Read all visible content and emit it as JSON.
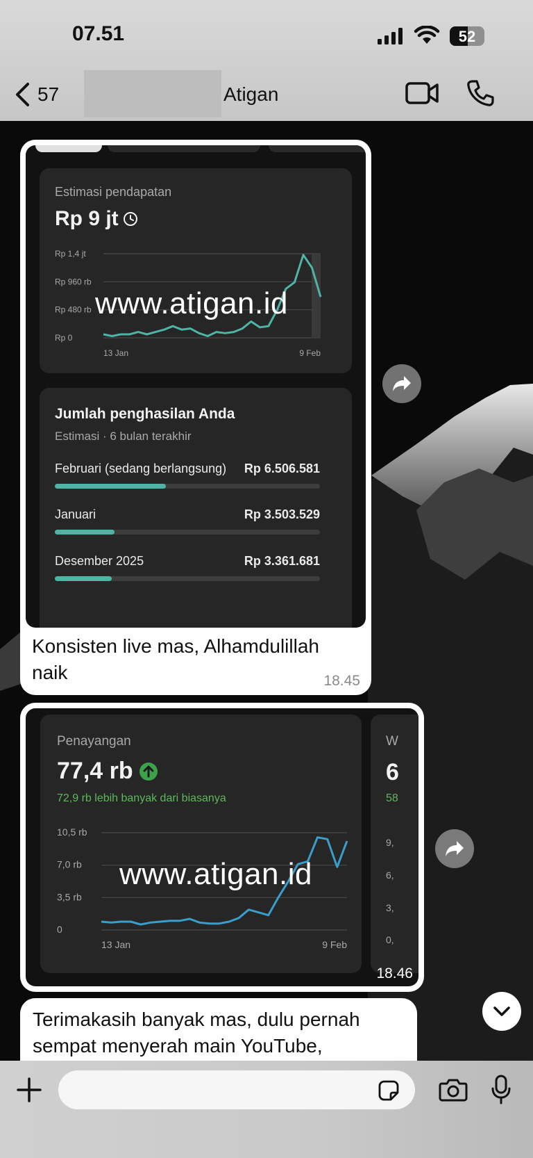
{
  "status": {
    "time": "07.51",
    "battery": "52",
    "battery_level": 0.52
  },
  "header": {
    "back_count": "57",
    "contact_name": "Atigan"
  },
  "message1": {
    "card_earnings": {
      "title": "Estimasi pendapatan",
      "value": "Rp 9 jt",
      "y_ticks": [
        "Rp 1,4 jt",
        "Rp 960 rb",
        "Rp 480 rb",
        "Rp 0"
      ],
      "x_start": "13 Jan",
      "x_end": "9 Feb"
    },
    "card_income": {
      "title": "Jumlah penghasilan Anda",
      "subtitle": "Estimasi · 6 bulan terakhir",
      "rows": [
        {
          "label": "Februari (sedang berlangsung)",
          "amount": "Rp 6.506.581",
          "share": 0.42
        },
        {
          "label": "Januari",
          "amount": "Rp 3.503.529",
          "share": 0.225
        },
        {
          "label": "Desember 2025",
          "amount": "Rp 3.361.681",
          "share": 0.215
        }
      ]
    },
    "watermark": "www.atigan.id",
    "text": "Konsisten live mas, Alhamdulillah naik",
    "time": "18.45"
  },
  "message2": {
    "card_views": {
      "title": "Penayangan",
      "value": "77,4 rb",
      "subtitle": "72,9 rb lebih banyak dari biasanya",
      "y_ticks": [
        "10,5 rb",
        "7,0 rb",
        "3,5 rb",
        "0"
      ],
      "x_start": "13 Jan",
      "x_end": "9 Feb"
    },
    "card_next_partial": {
      "title": "W",
      "value": "6",
      "subtitle": "58",
      "ticks": [
        "9,",
        "6,",
        "3,",
        "0,"
      ]
    },
    "watermark": "www.atigan.id",
    "time": "18.46"
  },
  "message3": {
    "text": "Terimakasih banyak mas, dulu pernah sempat menyerah main YouTube,"
  },
  "chart_data": [
    {
      "type": "line",
      "title": "Estimasi pendapatan",
      "x_range": [
        "13 Jan",
        "9 Feb"
      ],
      "y_ticks": [
        "Rp 0",
        "Rp 480 rb",
        "Rp 960 rb",
        "Rp 1,4 jt"
      ],
      "ylim": [
        0,
        1440000
      ],
      "series": [
        {
          "values": [
            60000,
            30000,
            60000,
            60000,
            100000,
            60000,
            100000,
            140000,
            200000,
            140000,
            160000,
            80000,
            30000,
            100000,
            80000,
            100000,
            160000,
            280000,
            180000,
            200000,
            480000,
            840000,
            950000,
            1420000,
            1200000,
            700000
          ]
        }
      ],
      "grid": true,
      "color": "#4fb3a6"
    },
    {
      "type": "line",
      "title": "Penayangan",
      "x_range": [
        "13 Jan",
        "9 Feb"
      ],
      "y_ticks": [
        "0",
        "3,5 rb",
        "7,0 rb",
        "10,5 rb"
      ],
      "ylim": [
        0,
        10500
      ],
      "series": [
        {
          "values": [
            900,
            800,
            900,
            900,
            600,
            800,
            900,
            1000,
            1000,
            1200,
            800,
            700,
            700,
            900,
            1300,
            2200,
            1900,
            1600,
            3500,
            5200,
            7100,
            7400,
            10000,
            9800,
            6800,
            9600
          ]
        }
      ],
      "grid": true,
      "color": "#3a9ecb"
    }
  ]
}
